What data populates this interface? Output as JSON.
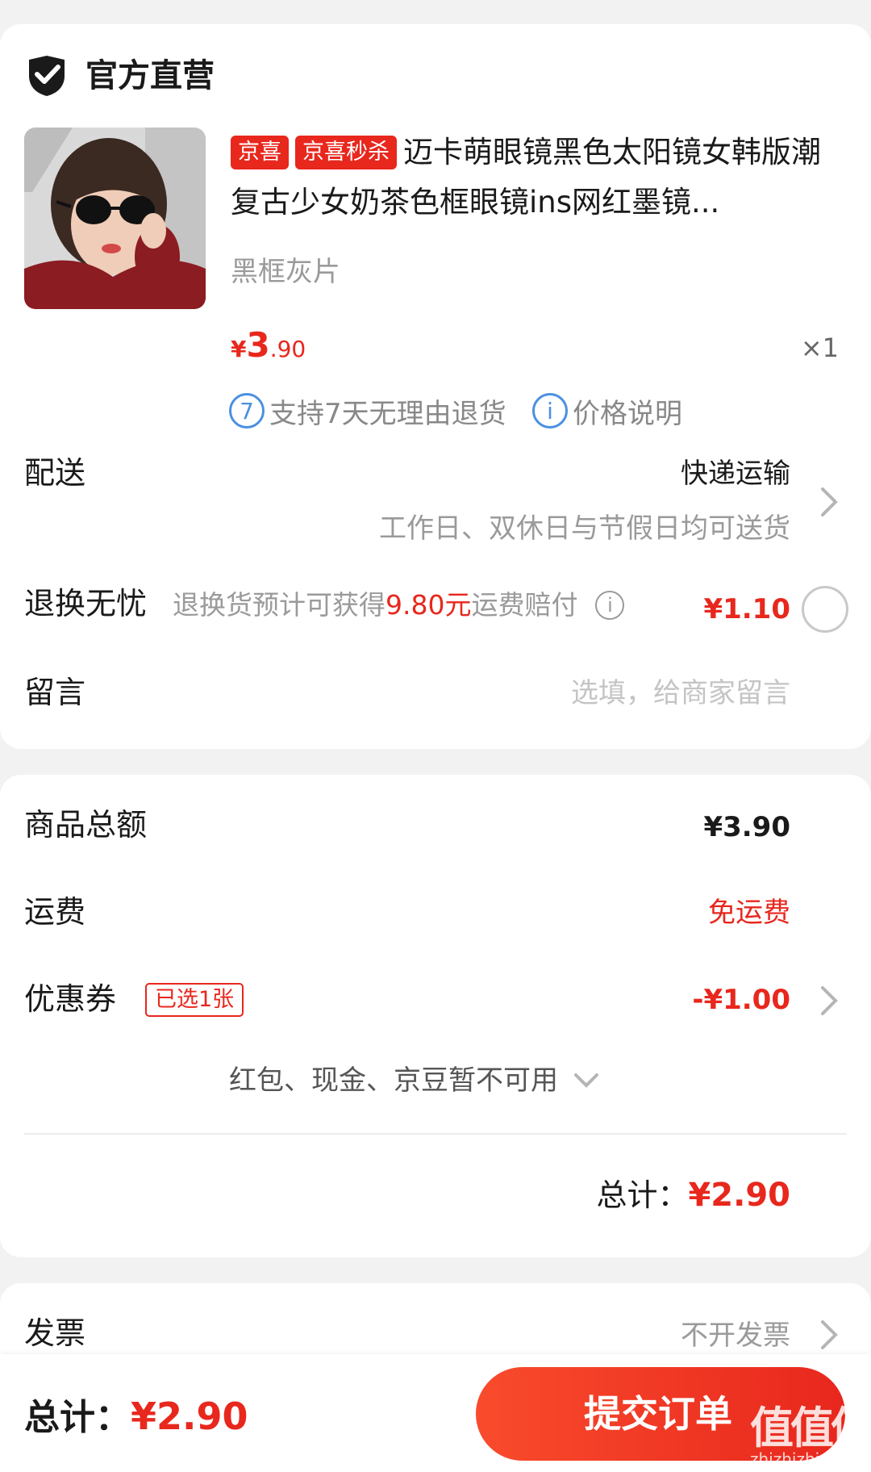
{
  "store": {
    "name": "官方直营",
    "icon": "shield-check-icon"
  },
  "product": {
    "tags": [
      "京喜",
      "京喜秒杀"
    ],
    "title": "迈卡萌眼镜黑色太阳镜女韩版潮复古少女奶茶色框眼镜ins网红墨镜...",
    "variant": "黑框灰片",
    "price_symbol": "¥",
    "price_int": "3",
    "price_dec": ".90",
    "quantity": "×1",
    "image": "woman-with-sunglasses-photo"
  },
  "services": [
    {
      "icon_text": "7",
      "label": "支持7天无理由退货"
    },
    {
      "icon_text": "i",
      "label": "价格说明"
    }
  ],
  "delivery": {
    "label": "配送",
    "method": "快递运输",
    "note": "工作日、双休日与节假日均可送货"
  },
  "return_insurance": {
    "label": "退换无忧",
    "desc_prefix": "退换货预计可获得",
    "desc_amount": "9.80元",
    "desc_suffix": "运费赔付",
    "info_icon": "i",
    "price": "¥1.10",
    "checked": false
  },
  "message": {
    "label": "留言",
    "placeholder": "选填，给商家留言"
  },
  "summary": {
    "goods_total_label": "商品总额",
    "goods_total_value": "¥3.90",
    "shipping_label": "运费",
    "shipping_value": "免运费",
    "coupon_label": "优惠券",
    "coupon_badge": "已选1张",
    "coupon_value": "-¥1.00",
    "unavailable_note": "红包、现金、京豆暂不可用",
    "total_label": "总计：",
    "total_value": "¥2.90"
  },
  "invoice": {
    "label": "发票",
    "value": "不开发票"
  },
  "bottom_bar": {
    "total_label": "总计：",
    "total_value": "¥2.90",
    "submit_label": "提交订单",
    "watermark": "值值值",
    "watermark_sub": "zhizhizhi.com"
  },
  "colors": {
    "accent": "#e8271d",
    "info_blue": "#4a90e2",
    "background": "#f2f2f2"
  }
}
